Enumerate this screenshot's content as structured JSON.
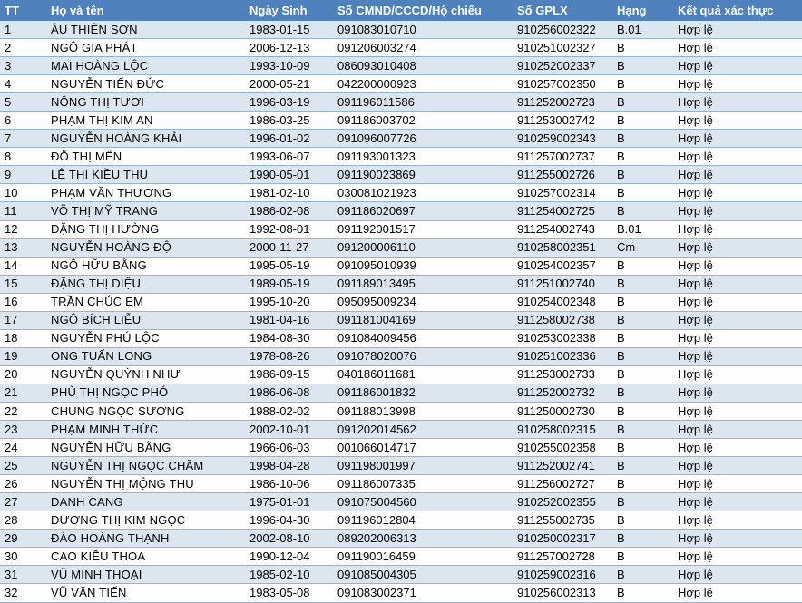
{
  "table": {
    "headers": [
      "TT",
      "Họ và tên",
      "Ngày Sinh",
      "Số CMND/CCCD/Hộ chiếu",
      "Số GPLX",
      "Hạng",
      "Kết quả xác thực"
    ],
    "rows": [
      [
        "1",
        "ÂU THIÊN SƠN",
        "1983-01-15",
        "091083010710",
        "910256002322",
        "B.01",
        "Hợp lệ"
      ],
      [
        "2",
        "NGÔ GIA PHÁT",
        "2006-12-13",
        "091206003274",
        "910251002327",
        "B",
        "Hợp lệ"
      ],
      [
        "3",
        "MAI HOÀNG LỘC",
        "1993-10-09",
        "086093010408",
        "910252002337",
        "B",
        "Hợp lệ"
      ],
      [
        "4",
        "NGUYỄN TIẾN ĐỨC",
        "2000-05-21",
        "042200000923",
        "910257002350",
        "B",
        "Hợp lệ"
      ],
      [
        "5",
        "NÔNG THỊ TƯƠI",
        "1996-03-19",
        "091196011586",
        "911252002723",
        "B",
        "Hợp lệ"
      ],
      [
        "6",
        "PHẠM THỊ KIM AN",
        "1986-03-25",
        "091186003702",
        "911253002742",
        "B",
        "Hợp lệ"
      ],
      [
        "7",
        "NGUYỄN HOÀNG KHẢI",
        "1996-01-02",
        "091096007726",
        "910259002343",
        "B",
        "Hợp lệ"
      ],
      [
        "8",
        "ĐỖ THỊ MẾN",
        "1993-06-07",
        "091193001323",
        "911257002737",
        "B",
        "Hợp lệ"
      ],
      [
        "9",
        "LÊ THỊ KIỀU THU",
        "1990-05-01",
        "091190023869",
        "911255002726",
        "B",
        "Hợp lệ"
      ],
      [
        "10",
        "PHẠM VĂN THƯƠNG",
        "1981-02-10",
        "030081021923",
        "910257002314",
        "B",
        "Hợp lệ"
      ],
      [
        "11",
        "VÕ THỊ MỸ TRANG",
        "1986-02-08",
        "091186020697",
        "911254002725",
        "B",
        "Hợp lệ"
      ],
      [
        "12",
        "ĐẶNG THỊ HƯỜNG",
        "1992-08-01",
        "091192001517",
        "911254002743",
        "B.01",
        "Hợp lệ"
      ],
      [
        "13",
        "NGUYỄN HOÀNG ĐỘ",
        "2000-11-27",
        "091200006110",
        "910258002351",
        "Cm",
        "Hợp lệ"
      ],
      [
        "14",
        "NGÔ HỮU BẰNG",
        "1995-05-19",
        "091095010939",
        "910254002357",
        "B",
        "Hợp lệ"
      ],
      [
        "15",
        "ĐẶNG THỊ DIỆU",
        "1989-05-19",
        "091189013495",
        "911251002740",
        "B",
        "Hợp lệ"
      ],
      [
        "16",
        "TRẦN CHÚC EM",
        "1995-10-20",
        "095095009234",
        "910254002348",
        "B",
        "Hợp lệ"
      ],
      [
        "17",
        "NGÔ BÍCH LIỄU",
        "1981-04-16",
        "091181004169",
        "911258002738",
        "B",
        "Hợp lệ"
      ],
      [
        "18",
        "NGUYỄN PHÚ LỘC",
        "1984-08-30",
        "091084009456",
        "910253002338",
        "B",
        "Hợp lệ"
      ],
      [
        "19",
        "ONG TUẤN LONG",
        "1978-08-26",
        "091078020076",
        "910251002336",
        "B",
        "Hợp lệ"
      ],
      [
        "20",
        "NGUYỄN QUỲNH NHƯ",
        "1986-09-15",
        "040186011681",
        "911253002733",
        "B",
        "Hợp lệ"
      ],
      [
        "21",
        "PHÙ THỊ NGỌC PHÓ",
        "1986-06-08",
        "091186001832",
        "911252002732",
        "B",
        "Hợp lệ"
      ],
      [
        "22",
        "CHUNG NGỌC SƯƠNG",
        "1988-02-02",
        "091188013998",
        "911250002730",
        "B",
        "Hợp lệ"
      ],
      [
        "23",
        "PHẠM MINH THỨC",
        "2002-10-01",
        "091202014562",
        "910258002315",
        "B",
        "Hợp lệ"
      ],
      [
        "24",
        "NGUYỄN HỮU BẰNG",
        "1966-06-03",
        "001066014717",
        "910255002358",
        "B",
        "Hợp lệ"
      ],
      [
        "25",
        "NGUYỄN THỊ NGỌC CHĂM",
        "1998-04-28",
        "091198001997",
        "911252002741",
        "B",
        "Hợp lệ"
      ],
      [
        "26",
        "NGUYỄN THỊ MỘNG THU",
        "1986-10-06",
        "091186007335",
        "911256002727",
        "B",
        "Hợp lệ"
      ],
      [
        "27",
        "DANH CANG",
        "1975-01-01",
        "091075004560",
        "910252002355",
        "B",
        "Hợp lệ"
      ],
      [
        "28",
        "DƯƠNG THỊ KIM NGỌC",
        "1996-04-30",
        "091196012804",
        "911255002735",
        "B",
        "Hợp lệ"
      ],
      [
        "29",
        "ĐÀO HOÀNG THẠNH",
        "2002-08-10",
        "089202006313",
        "910250002317",
        "B",
        "Hợp lệ"
      ],
      [
        "30",
        "CAO KIỀU THOA",
        "1990-12-04",
        "091190016459",
        "911257002728",
        "B",
        "Hợp lệ"
      ],
      [
        "31",
        "VŨ MINH THOẠI",
        "1985-02-10",
        "091085004305",
        "910259002316",
        "B",
        "Hợp lệ"
      ],
      [
        "32",
        "VŨ VĂN TIẾN",
        "1983-05-08",
        "091083002371",
        "910256002313",
        "B",
        "Hợp lệ"
      ]
    ]
  },
  "colors": {
    "header_bg": "#4f81bd",
    "header_text": "#ffffff",
    "band": "#dce6f1",
    "rule": "#95b3d7"
  }
}
